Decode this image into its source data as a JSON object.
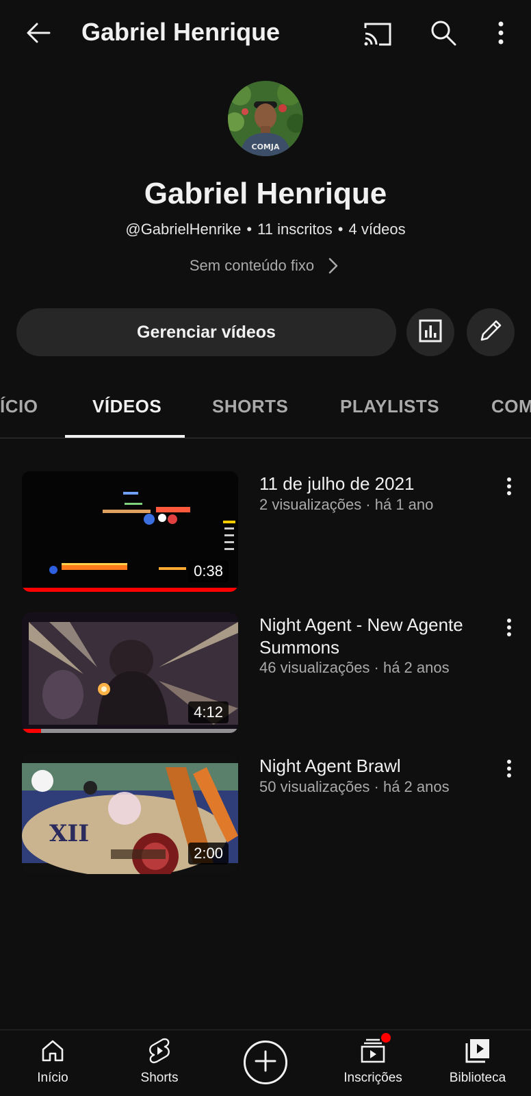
{
  "topbar": {
    "title": "Gabriel Henrique",
    "icons": [
      "back-arrow-icon",
      "cast-icon",
      "search-icon",
      "more-vert-icon"
    ]
  },
  "channel": {
    "name": "Gabriel Henrique",
    "handle": "@GabrielHenrike",
    "subscribers": "11 inscritos",
    "video_count": "4 vídeos",
    "separator": "•",
    "pinned_text": "Sem conteúdo fixo",
    "avatar_shirt_text": "COMJA"
  },
  "actions": {
    "manage_label": "Gerenciar vídeos",
    "stats_icon": "analytics-icon",
    "edit_icon": "pencil-icon"
  },
  "tabs": [
    {
      "label": "ÍCIO",
      "active": false
    },
    {
      "label": "VÍDEOS",
      "active": true
    },
    {
      "label": "SHORTS",
      "active": false
    },
    {
      "label": "PLAYLISTS",
      "active": false
    },
    {
      "label": "COM",
      "active": false
    }
  ],
  "videos": [
    {
      "title": "11 de julho de 2021",
      "meta": "2 visualizações · há 1 ano",
      "duration": "0:38",
      "watched_fraction": 1.0
    },
    {
      "title": "Night Agent - New Agente Summons",
      "meta": "46 visualizações · há 2 anos",
      "duration": "4:12",
      "watched_fraction": 0.09
    },
    {
      "title": "Night Agent Brawl",
      "meta": "50 visualizações · há 2 anos",
      "duration": "2:00",
      "watched_fraction": 0
    }
  ],
  "bottomnav": {
    "items": [
      {
        "label": "Início",
        "icon": "home-icon"
      },
      {
        "label": "Shorts",
        "icon": "shorts-icon"
      },
      {
        "label": "",
        "icon": "create-plus-icon"
      },
      {
        "label": "Inscrições",
        "icon": "subscriptions-icon"
      },
      {
        "label": "Biblioteca",
        "icon": "library-icon"
      }
    ]
  },
  "colors": {
    "background": "#0f0f0f",
    "surface": "#272727",
    "text_primary": "#f1f1f1",
    "text_secondary": "#aaaaaa",
    "accent_red": "#ff0000"
  }
}
